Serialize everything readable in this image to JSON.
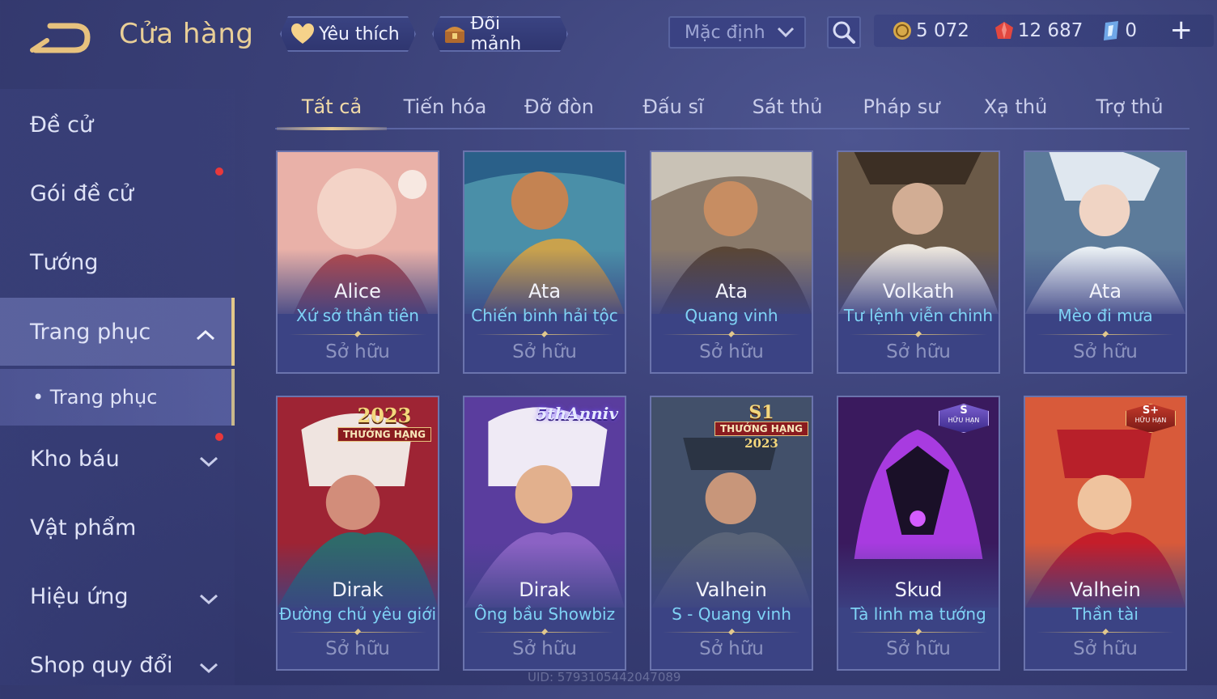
{
  "header": {
    "title": "Cửa hàng",
    "favorite_label": "Yêu thích",
    "trade_label": "Đổi mảnh",
    "sort_value": "Mặc định"
  },
  "currency": {
    "gold": "5 072",
    "vouchers": "12 687",
    "shards": "0"
  },
  "sidebar": {
    "items": [
      {
        "label": "Đề cử"
      },
      {
        "label": "Gói đề cử"
      },
      {
        "label": "Tướng"
      },
      {
        "label": "Trang phục"
      },
      {
        "label": "• Trang phục"
      },
      {
        "label": "Kho báu"
      },
      {
        "label": "Vật phẩm"
      },
      {
        "label": "Hiệu ứng"
      },
      {
        "label": "Shop quy đổi"
      }
    ]
  },
  "tabs": [
    "Tất cả",
    "Tiến hóa",
    "Đỡ đòn",
    "Đấu sĩ",
    "Sát thủ",
    "Pháp sư",
    "Xạ thủ",
    "Trợ thủ"
  ],
  "cards": [
    {
      "hero": "Alice",
      "skin": "Xứ sở thần tiên",
      "status": "Sở hữu"
    },
    {
      "hero": "Ata",
      "skin": "Chiến binh hải tộc",
      "status": "Sở hữu"
    },
    {
      "hero": "Ata",
      "skin": "Quang vinh",
      "status": "Sở hữu"
    },
    {
      "hero": "Volkath",
      "skin": "Tư lệnh viễn chinh",
      "status": "Sở hữu"
    },
    {
      "hero": "Ata",
      "skin": "Mèo đi mưa",
      "status": "Sở hữu"
    },
    {
      "hero": "Dirak",
      "skin": "Đường chủ yêu giới",
      "status": "Sở hữu",
      "badge_top": "2023",
      "badge_bottom": "THƯỞNG HẠNG"
    },
    {
      "hero": "Dirak",
      "skin": "Ông bầu Showbiz",
      "status": "Sở hữu",
      "badge_top": "5thAnniv"
    },
    {
      "hero": "Valhein",
      "skin": "S - Quang vinh",
      "status": "Sở hữu",
      "badge_top": "S1",
      "badge_mid": "THƯỞNG HẠNG",
      "badge_bottom": "2023"
    },
    {
      "hero": "Skud",
      "skin": "Tà linh ma tướng",
      "status": "Sở hữu",
      "badge_top": "S",
      "badge_bottom": "HỮU HẠN"
    },
    {
      "hero": "Valhein",
      "skin": "Thần tài",
      "status": "Sở hữu",
      "badge_top": "S+",
      "badge_bottom": "HỮU HẠN"
    }
  ],
  "footer": {
    "uid": "UID: 5793105442047089"
  },
  "colors": {
    "accent_gold": "#e6ca90",
    "skin_name": "#7fd3f5",
    "notification": "#e8383b"
  }
}
